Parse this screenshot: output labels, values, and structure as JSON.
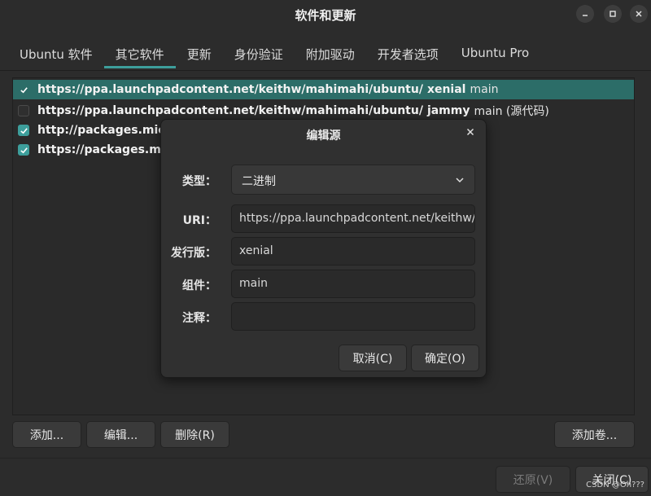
{
  "window": {
    "title": "软件和更新"
  },
  "tabs": [
    {
      "label": "Ubuntu 软件"
    },
    {
      "label": "其它软件"
    },
    {
      "label": "更新"
    },
    {
      "label": "身份验证"
    },
    {
      "label": "附加驱动"
    },
    {
      "label": "开发者选项"
    },
    {
      "label": "Ubuntu Pro"
    }
  ],
  "sources": [
    {
      "checked": true,
      "url": "https://ppa.launchpadcontent.net/keithw/mahimahi/ubuntu/",
      "dist": "xenial",
      "comp": "main"
    },
    {
      "checked": false,
      "url": "https://ppa.launchpadcontent.net/keithw/mahimahi/ubuntu/",
      "dist": "jammy",
      "comp": "main (源代码)"
    },
    {
      "checked": true,
      "url": "http://packages.micro",
      "dist": "",
      "comp": ""
    },
    {
      "checked": true,
      "url": "https://packages.micr",
      "dist": "",
      "comp": ""
    }
  ],
  "buttons": {
    "add": "添加...",
    "edit": "编辑...",
    "remove": "删除(R)",
    "add_volume": "添加卷...",
    "revert": "还原(V)",
    "close": "关闭(C)"
  },
  "dialog": {
    "title": "编辑源",
    "type_label": "类型：",
    "type_value": "二进制",
    "uri_label": "URI：",
    "uri_value": "https://ppa.launchpadcontent.net/keithw/",
    "dist_label": "发行版：",
    "dist_value": "xenial",
    "comp_label": "组件：",
    "comp_value": "main",
    "comment_label": "注释：",
    "comment_value": "",
    "cancel": "取消(C)",
    "ok": "确定(O)"
  },
  "watermark": "CSDN @Oh???",
  "colors": {
    "accent": "#3d9e9b",
    "selected_row": "#2c6d68",
    "background": "#2c2c2c"
  }
}
